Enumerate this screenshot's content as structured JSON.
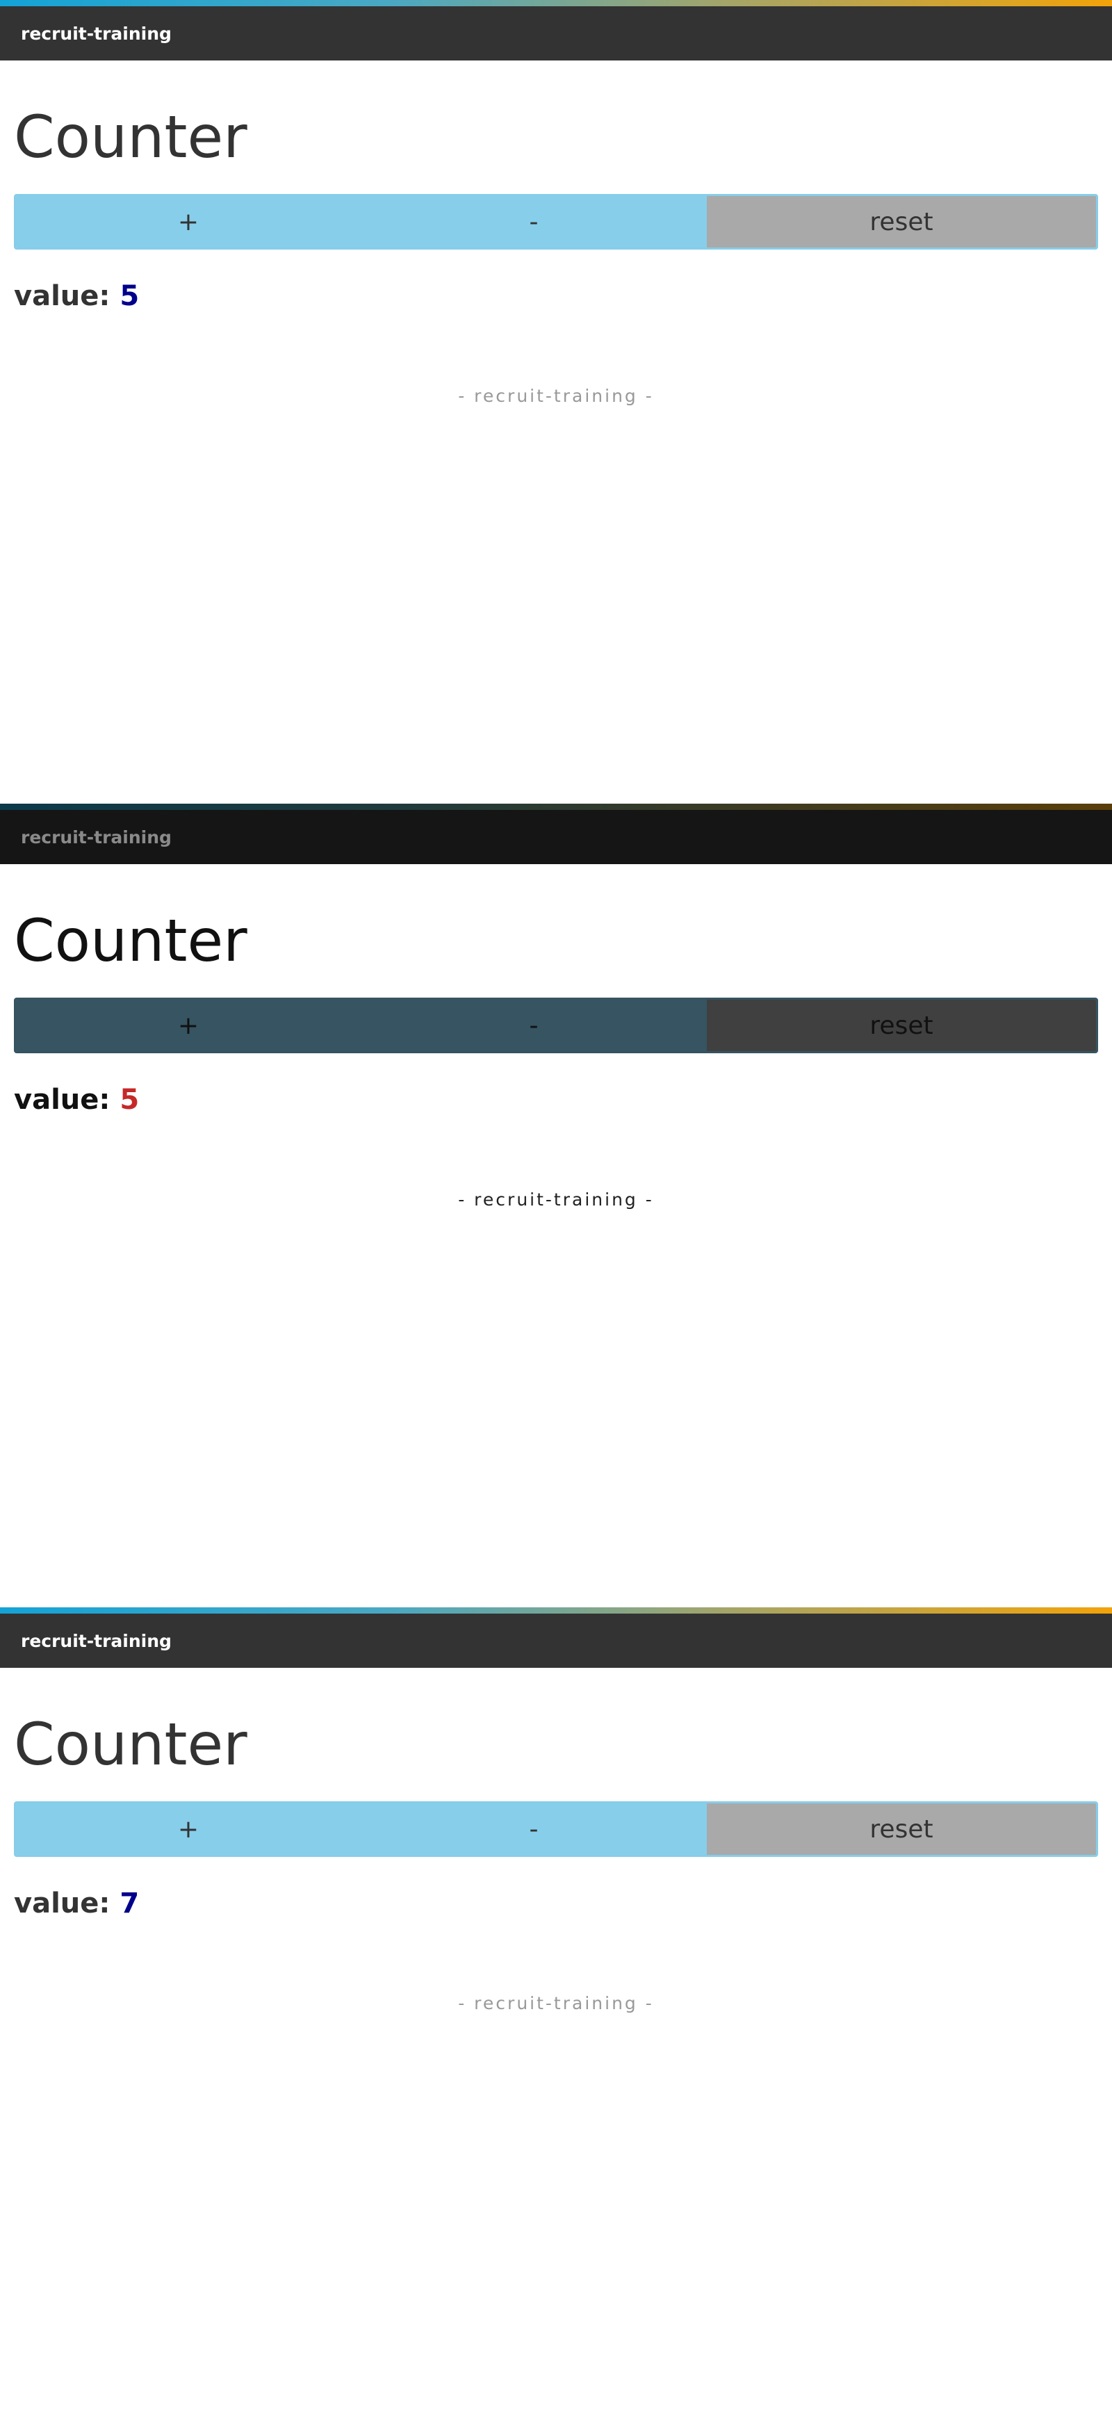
{
  "frames": [
    {
      "brand": "recruit-training",
      "title": "Counter",
      "buttons": {
        "increment": "+",
        "decrement": "-",
        "reset": "reset"
      },
      "value_label": "value:",
      "value": "5",
      "footer": "- recruit-training -"
    },
    {
      "brand": "recruit-training",
      "title": "Counter",
      "buttons": {
        "increment": "+",
        "decrement": "-",
        "reset": "reset"
      },
      "value_label": "value:",
      "value": "5",
      "footer": "- recruit-training -"
    },
    {
      "brand": "recruit-training",
      "title": "Counter",
      "buttons": {
        "increment": "+",
        "decrement": "-",
        "reset": "reset"
      },
      "value_label": "value:",
      "value": "7",
      "footer": "- recruit-training -"
    }
  ],
  "colors": {
    "header_bg": "#333333",
    "button_blue": "#87ceeb",
    "button_gray": "#a9a9a9",
    "value_color": "#00008b",
    "value_color_dimmed": "#c62828",
    "footer_text": "#999999"
  }
}
